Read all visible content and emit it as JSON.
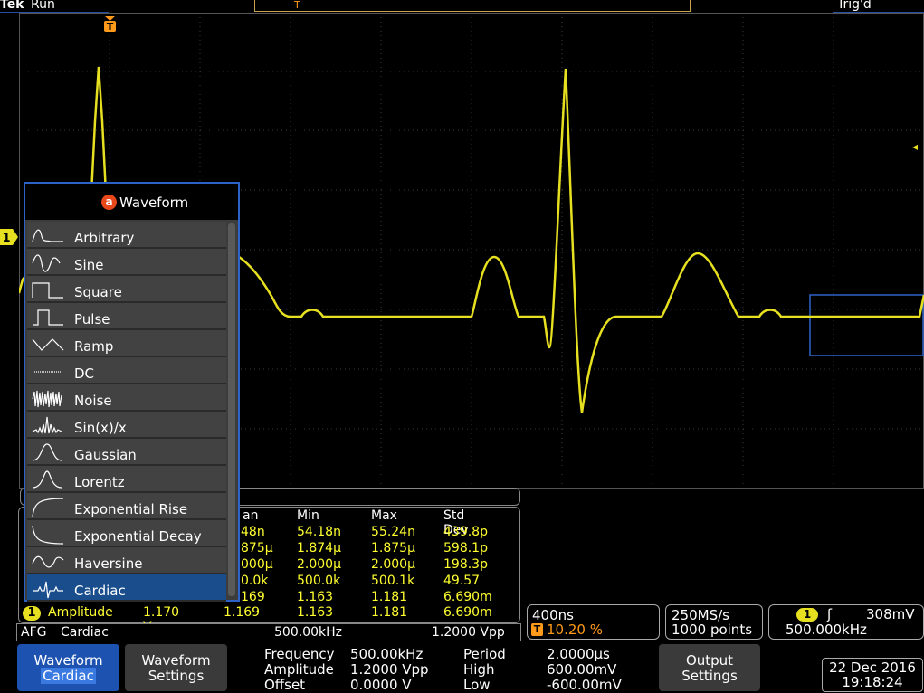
{
  "topbar": {
    "brand": "Tek",
    "run_state": "Run",
    "trigger_state": "Trig'd"
  },
  "markers": {
    "trigger": "T",
    "channel": "1",
    "afg": "a"
  },
  "colors": {
    "trace": "#e6e020",
    "accent": "#1e52b0",
    "trigger": "#ff9a1a"
  },
  "waveform_menu": {
    "title": "Waveform",
    "items": [
      {
        "label": "Arbitrary",
        "icon": "arbitrary-wave-icon"
      },
      {
        "label": "Sine",
        "icon": "sine-wave-icon"
      },
      {
        "label": "Square",
        "icon": "square-wave-icon"
      },
      {
        "label": "Pulse",
        "icon": "pulse-wave-icon"
      },
      {
        "label": "Ramp",
        "icon": "ramp-wave-icon"
      },
      {
        "label": "DC",
        "icon": "dc-wave-icon"
      },
      {
        "label": "Noise",
        "icon": "noise-wave-icon"
      },
      {
        "label": "Sin(x)/x",
        "icon": "sinc-wave-icon"
      },
      {
        "label": "Gaussian",
        "icon": "gaussian-wave-icon"
      },
      {
        "label": "Lorentz",
        "icon": "lorentz-wave-icon"
      },
      {
        "label": "Exponential Rise",
        "icon": "exp-rise-wave-icon"
      },
      {
        "label": "Exponential Decay",
        "icon": "exp-decay-wave-icon"
      },
      {
        "label": "Haversine",
        "icon": "haversine-wave-icon"
      },
      {
        "label": "Cardiac",
        "icon": "cardiac-wave-icon",
        "selected": true
      }
    ]
  },
  "measurements": {
    "headers": [
      "an",
      "Min",
      "Max",
      "Std Dev"
    ],
    "rows": [
      [
        "48n",
        "54.18n",
        "55.24n",
        "439.8p"
      ],
      [
        "875µ",
        "1.874µ",
        "1.875µ",
        "598.1p"
      ],
      [
        "000µ",
        "2.000µ",
        "2.000µ",
        "198.3p"
      ],
      [
        "0.0k",
        "500.0k",
        "500.1k",
        "49.57"
      ],
      [
        "169",
        "1.163",
        "1.181",
        "6.690m"
      ]
    ],
    "amplitude_row": {
      "label": "Amplitude",
      "channel": "1",
      "values": [
        "1.170 V",
        "1.169",
        "1.163",
        "1.181",
        "6.690m"
      ]
    }
  },
  "afg_bar": {
    "label": "AFG",
    "wave": "Cardiac",
    "frequency": "500.00kHz",
    "amplitude": "1.2000 Vpp"
  },
  "horizontal": {
    "timebase": "400ns",
    "trigger_position": "10.20 %"
  },
  "acquisition": {
    "sample_rate": "250MS/s",
    "record_length": "1000 points"
  },
  "trigger": {
    "channel": "1",
    "level": "308mV",
    "frequency": "500.000kHz"
  },
  "bottom": {
    "waveform_btn": {
      "title": "Waveform",
      "value": "Cardiac"
    },
    "waveform_settings_btn": {
      "line1": "Waveform",
      "line2": "Settings"
    },
    "params": {
      "frequency_label": "Frequency",
      "frequency_value": "500.00kHz",
      "amplitude_label": "Amplitude",
      "amplitude_value": "1.2000 Vpp",
      "offset_label": "Offset",
      "offset_value": "0.0000 V",
      "period_label": "Period",
      "period_value": "2.0000µs",
      "high_label": "High",
      "high_value": "600.00mV",
      "low_label": "Low",
      "low_value": "-600.00mV"
    },
    "output_settings_btn": {
      "line1": "Output",
      "line2": "Settings"
    },
    "date": "22 Dec 2016",
    "time": "19:18:24"
  }
}
